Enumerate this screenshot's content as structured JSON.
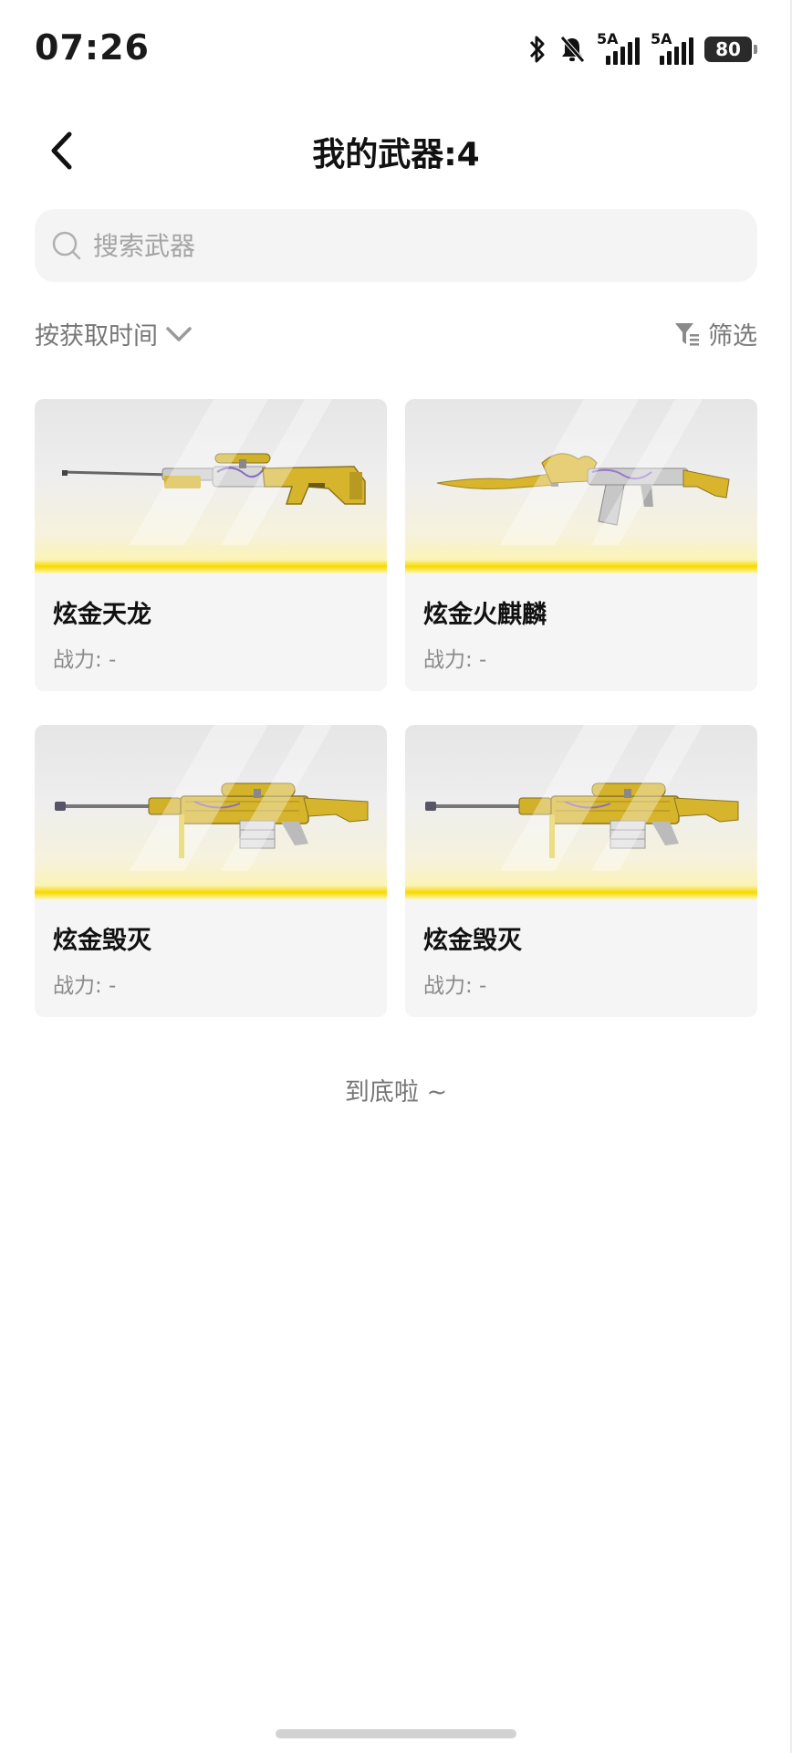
{
  "status_bar": {
    "time": "07:26",
    "network1": "5A",
    "network2": "5A",
    "battery": "80"
  },
  "header": {
    "title": "我的武器:4"
  },
  "search": {
    "placeholder": "搜索武器",
    "value": ""
  },
  "toolbar": {
    "sort_label": "按获取时间",
    "filter_label": "筛选"
  },
  "weapons": [
    {
      "name": "炫金天龙",
      "power_label": "战力: -",
      "icon": "sniper-rifle-awm"
    },
    {
      "name": "炫金火麒麟",
      "power_label": "战力: -",
      "icon": "assault-rifle-ak47"
    },
    {
      "name": "炫金毁灭",
      "power_label": "战力: -",
      "icon": "heavy-sniper-barrett"
    },
    {
      "name": "炫金毁灭",
      "power_label": "战力: -",
      "icon": "heavy-sniper-barrett"
    }
  ],
  "footer": {
    "end_text": "到底啦 ~"
  },
  "colors": {
    "accent_yellow": "#f6d900",
    "gold": "#c9a91c",
    "card_bg": "#f5f5f5"
  }
}
